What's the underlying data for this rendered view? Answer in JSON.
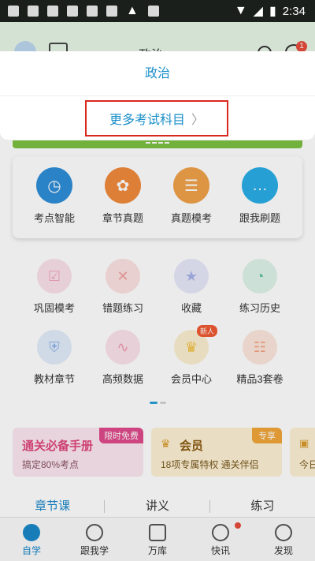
{
  "status_bar": {
    "time": "2:34"
  },
  "header": {
    "subject": "政治",
    "message_badge": "1"
  },
  "main_functions": [
    {
      "label": "考点智能",
      "icon": "clock-icon",
      "color": "#2f8fd8"
    },
    {
      "label": "章节真题",
      "icon": "brain-icon",
      "color": "#f08a3c"
    },
    {
      "label": "真题模考",
      "icon": "document-icon",
      "color": "#f0a24a"
    },
    {
      "label": "跟我刷题",
      "icon": "chat-icon",
      "color": "#2aaee6"
    }
  ],
  "grid_items": [
    {
      "label": "巩固模考",
      "icon": "checklist-icon",
      "color": "#f2a6bf"
    },
    {
      "label": "错题练习",
      "icon": "error-book-icon",
      "color": "#f0a3a0"
    },
    {
      "label": "收藏",
      "icon": "star-book-icon",
      "color": "#a9b2e8"
    },
    {
      "label": "练习历史",
      "icon": "history-icon",
      "color": "#5dc49a"
    },
    {
      "label": "教材章节",
      "icon": "shield-book-icon",
      "color": "#8fb6ea"
    },
    {
      "label": "高频数据",
      "icon": "chart-icon",
      "color": "#f09ab2"
    },
    {
      "label": "会员中心",
      "icon": "crown-icon",
      "color": "#f2bf3a",
      "tag": "新人"
    },
    {
      "label": "精品3套卷",
      "icon": "paper-icon",
      "color": "#f3a582"
    }
  ],
  "promos": {
    "handbook": {
      "title": "通关必备手册",
      "subtitle": "搞定80%考点",
      "tag": "限时免费"
    },
    "member": {
      "title": "会员",
      "subtitle": "18项专属特权 通关伴侣",
      "tag": "专享"
    },
    "today": {
      "subtitle": "今日"
    }
  },
  "content_tabs": [
    "章节课",
    "讲义",
    "练习"
  ],
  "bottom_nav": [
    {
      "label": "自学",
      "icon": "study-icon"
    },
    {
      "label": "跟我学",
      "icon": "check-circle-icon"
    },
    {
      "label": "万库",
      "icon": "library-icon"
    },
    {
      "label": "快讯",
      "icon": "flash-icon"
    },
    {
      "label": "发现",
      "icon": "compass-icon"
    }
  ],
  "dropdown": {
    "current": "政治",
    "more": "更多考试科目"
  },
  "colors": {
    "accent": "#1a88c9",
    "highlight_box": "#d9281e"
  }
}
